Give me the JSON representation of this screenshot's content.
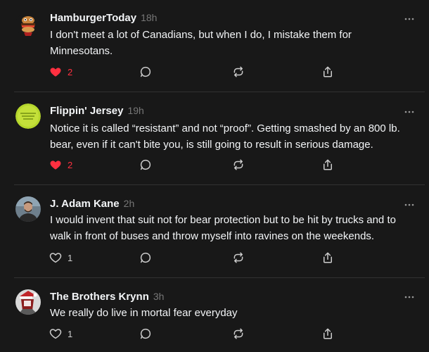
{
  "colors": {
    "background": "#181818",
    "text_primary": "#f3f5f7",
    "text_secondary": "#777777",
    "like_active": "#ff3040",
    "divider": "#323232"
  },
  "icons": {
    "more": "ellipsis-icon",
    "like": "heart-icon",
    "reply": "comment-bubble-icon",
    "repost": "repost-arrows-icon",
    "share": "share-upload-icon"
  },
  "posts": [
    {
      "username": "HamburgerToday",
      "time": "18h",
      "text": "I don't meet a lot of Canadians, but when I do, I mistake them for Minnesotans.",
      "likes": "2",
      "liked": true
    },
    {
      "username": "Flippin' Jersey",
      "time": "19h",
      "text": "Notice it is called “resistant” and not “proof”. Getting smashed by an 800 lb. bear, even if it can't bite you, is still going to result in serious damage.",
      "likes": "2",
      "liked": true
    },
    {
      "username": "J. Adam Kane",
      "time": "2h",
      "text": "I would invent that suit not for bear protection but to be hit by trucks and to walk in front of buses and throw myself into ravines on the weekends.",
      "likes": "1",
      "liked": false
    },
    {
      "username": "The Brothers Krynn",
      "time": "3h",
      "text": "We really do live in mortal fear everyday",
      "likes": "1",
      "liked": false
    }
  ]
}
